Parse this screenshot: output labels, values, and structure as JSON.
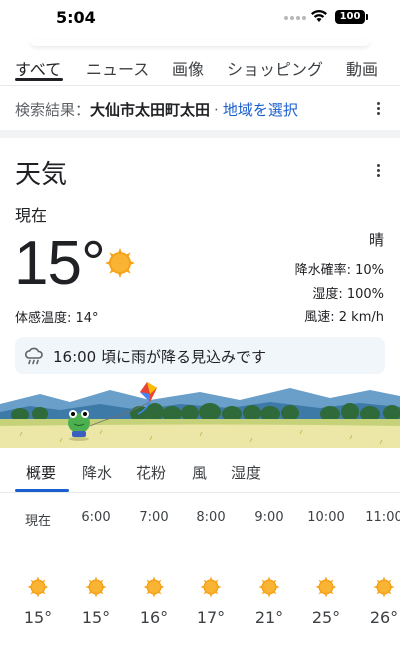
{
  "status_bar": {
    "time": "5:04",
    "battery": "100"
  },
  "search_tabs": [
    "すべて",
    "ニュース",
    "画像",
    "ショッピング",
    "動画"
  ],
  "location": {
    "prefix": "検索結果：",
    "place": "大仙市太田町太田",
    "separator": "·",
    "link": "地域を選択"
  },
  "weather": {
    "title": "天気",
    "now_label": "現在",
    "temperature": "15°",
    "condition": "晴",
    "precip": "降水確率: 10%",
    "humidity": "湿度: 100%",
    "wind": "風速: 2 km/h",
    "feels_like": "体感温度: 14°",
    "alert": "16:00 頃に雨が降る見込みです",
    "icon": "sun-icon"
  },
  "detail_tabs": [
    "概要",
    "降水",
    "花粉",
    "風",
    "湿度"
  ],
  "hourly": [
    {
      "time": "現在",
      "temp": "15°"
    },
    {
      "time": "6:00",
      "temp": "15°"
    },
    {
      "time": "7:00",
      "temp": "16°"
    },
    {
      "time": "8:00",
      "temp": "17°"
    },
    {
      "time": "9:00",
      "temp": "21°"
    },
    {
      "time": "10:00",
      "temp": "25°"
    },
    {
      "time": "11:00",
      "temp": "26°"
    }
  ],
  "colors": {
    "link": "#1a5fd0",
    "sun": "#f6a21a",
    "active_tab": "#1a5fd0"
  }
}
